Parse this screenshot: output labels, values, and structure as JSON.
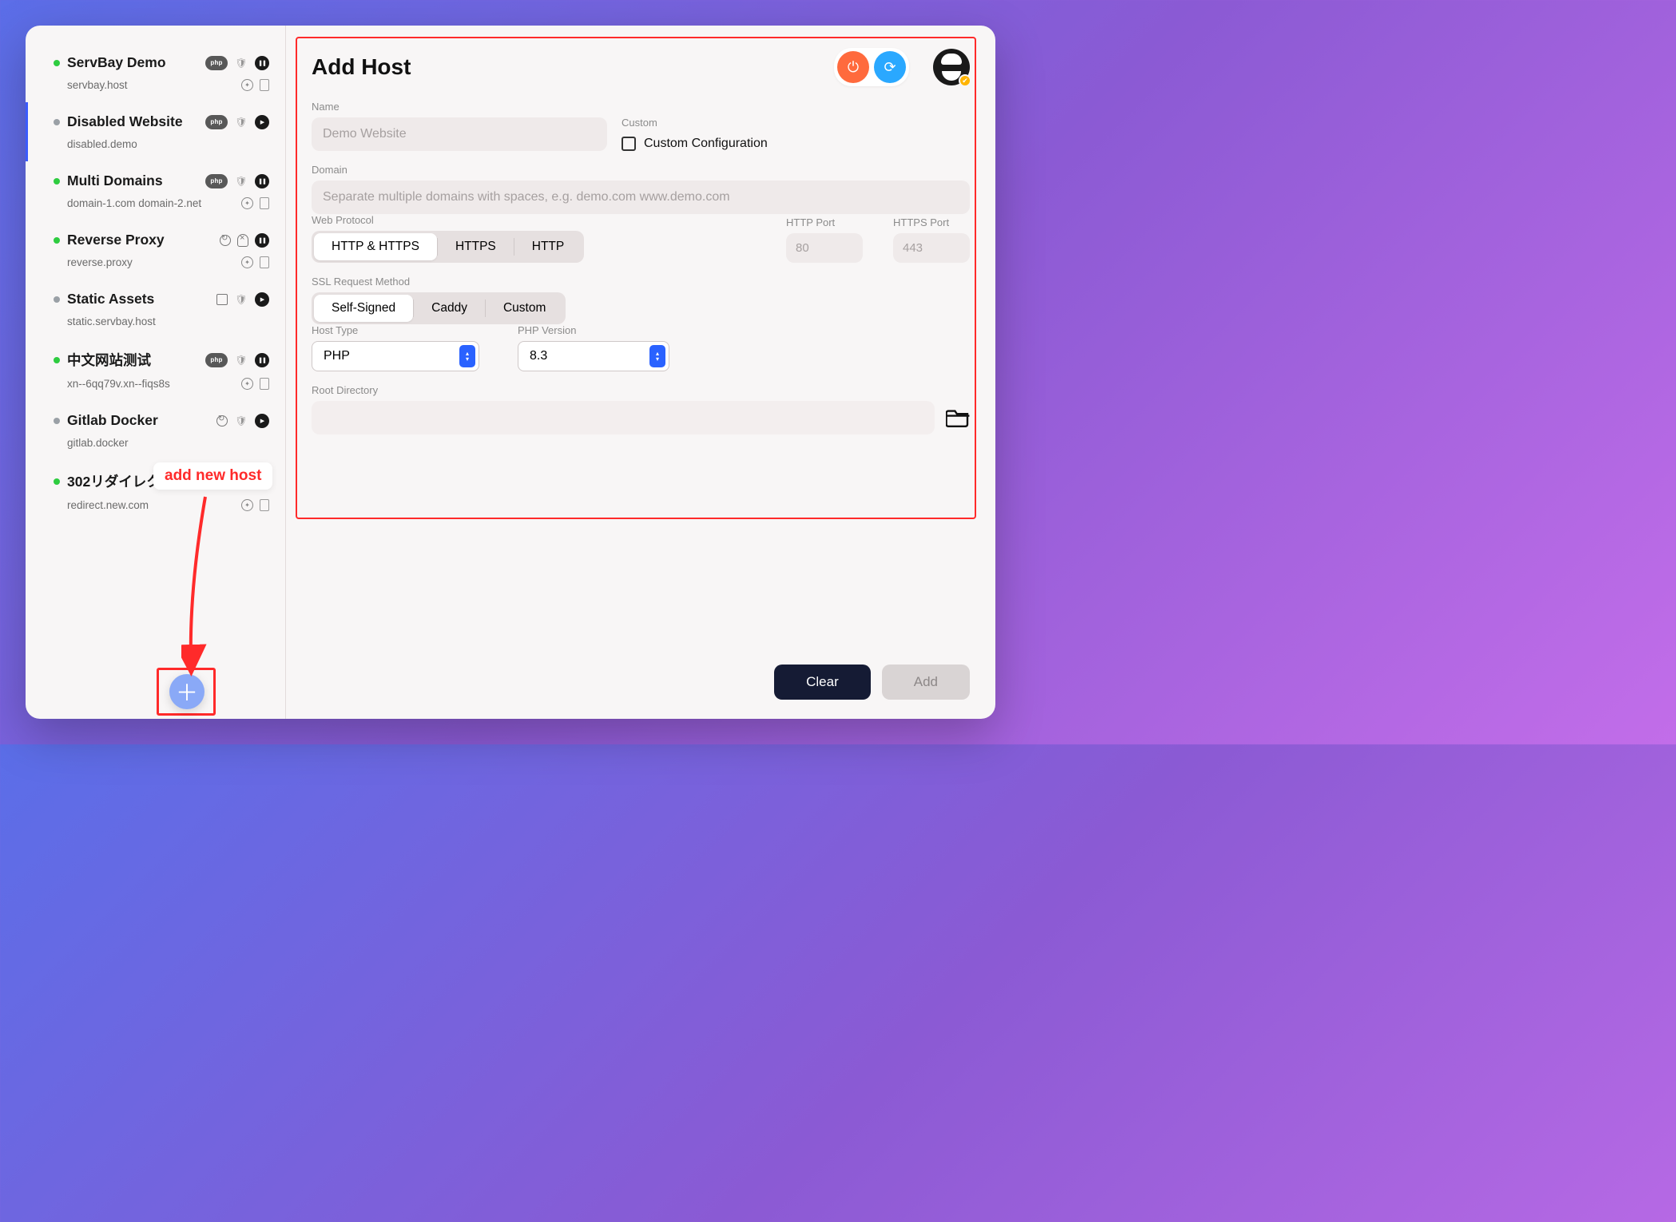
{
  "callout": "add new host",
  "sidebar": {
    "hosts": [
      {
        "name": "ServBay Demo",
        "sub": "servbay.host",
        "status": "green",
        "icons_top": [
          "php",
          "shield-o",
          "pause"
        ],
        "icons_bottom": [
          "compass",
          "doc"
        ],
        "selected": false
      },
      {
        "name": "Disabled Website",
        "sub": "disabled.demo",
        "status": "gray",
        "icons_top": [
          "php",
          "shield-o",
          "play"
        ],
        "icons_bottom": [],
        "selected": true
      },
      {
        "name": "Multi Domains",
        "sub": "domain-1.com domain-2.net",
        "status": "green",
        "icons_top": [
          "php",
          "shield-o",
          "pause"
        ],
        "icons_bottom": [
          "compass",
          "doc"
        ],
        "selected": false
      },
      {
        "name": "Reverse Proxy",
        "sub": "reverse.proxy",
        "status": "green",
        "icons_top": [
          "loop",
          "shield-x",
          "pause"
        ],
        "icons_bottom": [
          "compass",
          "doc"
        ],
        "selected": false
      },
      {
        "name": "Static Assets",
        "sub": "static.servbay.host",
        "status": "gray",
        "icons_top": [
          "box",
          "shield-o",
          "play"
        ],
        "icons_bottom": [],
        "selected": false
      },
      {
        "name": "中文网站测试",
        "sub": "xn--6qq79v.xn--fiqs8s",
        "status": "green",
        "icons_top": [
          "php",
          "shield-o",
          "pause"
        ],
        "icons_bottom": [
          "compass",
          "doc"
        ],
        "selected": false
      },
      {
        "name": "Gitlab Docker",
        "sub": "gitlab.docker",
        "status": "gray",
        "icons_top": [
          "loop",
          "shield-o",
          "play"
        ],
        "icons_bottom": [],
        "selected": false
      },
      {
        "name": "302リダイレクト",
        "sub": "redirect.new.com",
        "status": "green",
        "icons_top": [
          "redir",
          "shield-o",
          "pause"
        ],
        "icons_bottom": [
          "compass",
          "doc"
        ],
        "selected": false
      }
    ]
  },
  "main": {
    "title": "Add Host",
    "labels": {
      "name": "Name",
      "custom": "Custom",
      "custom_conf": "Custom Configuration",
      "domain": "Domain",
      "web_protocol": "Web Protocol",
      "http_port": "HTTP Port",
      "https_port": "HTTPS Port",
      "ssl": "SSL Request Method",
      "host_type": "Host Type",
      "php_version": "PHP Version",
      "root_dir": "Root Directory"
    },
    "placeholders": {
      "name": "Demo Website",
      "domain": "Separate multiple domains with spaces, e.g. demo.com www.demo.com",
      "http_port": "80",
      "https_port": "443"
    },
    "protocol_options": [
      "HTTP & HTTPS",
      "HTTPS",
      "HTTP"
    ],
    "protocol_selected": "HTTP & HTTPS",
    "ssl_options": [
      "Self-Signed",
      "Caddy",
      "Custom"
    ],
    "ssl_selected": "Self-Signed",
    "host_type_value": "PHP",
    "php_version_value": "8.3",
    "footer": {
      "clear": "Clear",
      "add": "Add"
    }
  }
}
